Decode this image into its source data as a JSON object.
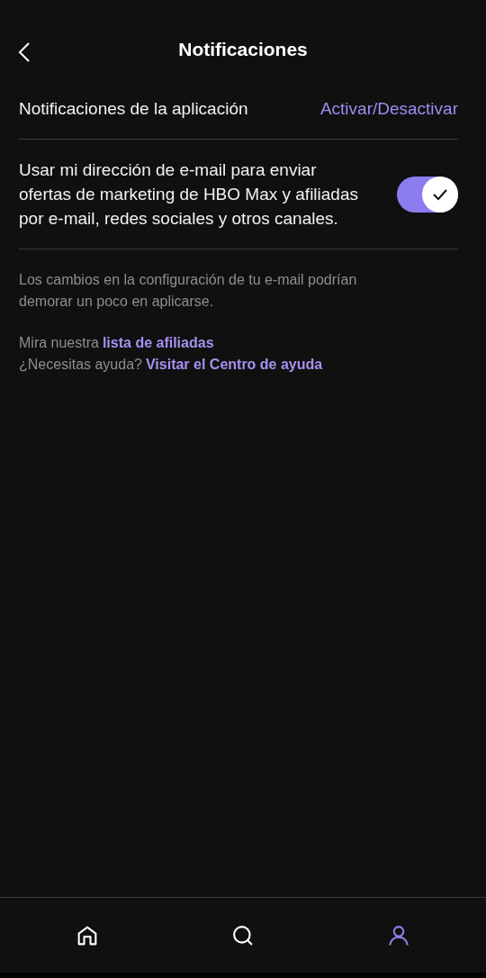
{
  "header": {
    "title": "Notificaciones"
  },
  "app_notifications": {
    "label": "Notificaciones de la aplicación",
    "action": "Activar/Desactivar"
  },
  "marketing": {
    "text": "Usar mi dirección de e-mail para enviar ofertas de marketing de HBO Max y afiliadas por e-mail, redes sociales y otros canales.",
    "on": true
  },
  "note": "Los cambios en la configuración de tu e-mail podrían demorar un poco en aplicarse.",
  "links": [
    {
      "prefix": "Mira nuestra",
      "link": "lista de afiliadas"
    },
    {
      "prefix": "¿Necesitas ayuda?",
      "link": "Visitar el Centro de ayuda"
    }
  ],
  "nav": [
    {
      "kind": "home",
      "selected": false
    },
    {
      "kind": "search",
      "selected": false
    },
    {
      "kind": "profile",
      "selected": true
    }
  ]
}
